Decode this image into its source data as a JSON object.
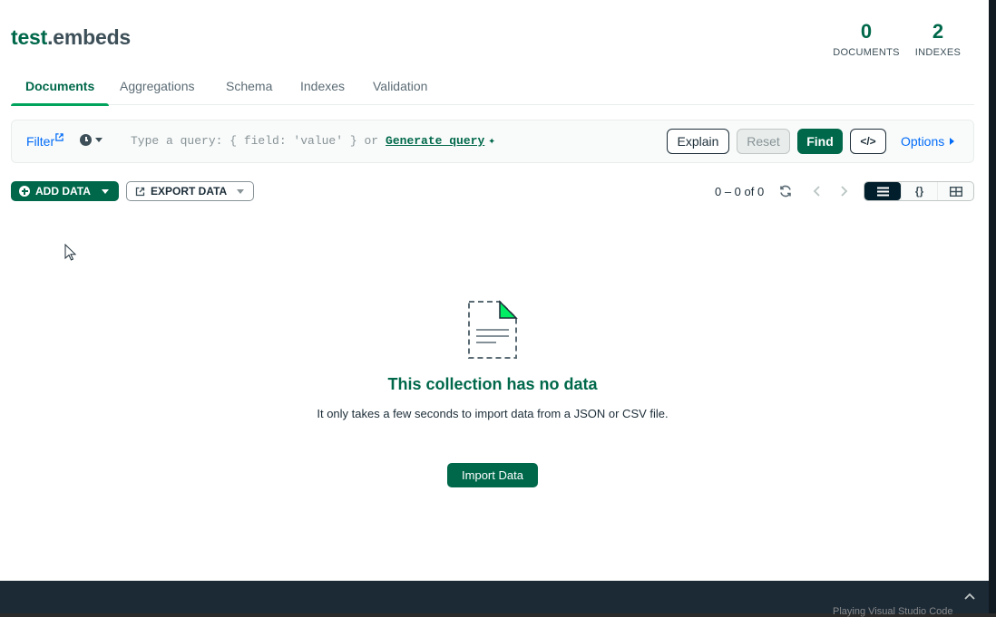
{
  "namespace": {
    "db": "test",
    "collection": ".embeds"
  },
  "stats": {
    "documents": {
      "value": "0",
      "label": "DOCUMENTS"
    },
    "indexes": {
      "value": "2",
      "label": "INDEXES"
    }
  },
  "tabs": [
    {
      "label": "Documents",
      "active": true
    },
    {
      "label": "Aggregations"
    },
    {
      "label": "Schema"
    },
    {
      "label": "Indexes"
    },
    {
      "label": "Validation"
    }
  ],
  "query_bar": {
    "filter_label": "Filter",
    "placeholder": "Type a query: { field: 'value' } or",
    "generate_label": "Generate query",
    "explain_label": "Explain",
    "reset_label": "Reset",
    "find_label": "Find",
    "code_label": "</>",
    "options_label": "Options"
  },
  "toolbar": {
    "add_data_label": "ADD DATA",
    "export_data_label": "EXPORT DATA",
    "pagination": "0 – 0 of 0",
    "view_modes": [
      "list",
      "json",
      "table"
    ]
  },
  "empty_state": {
    "title": "This collection has no data",
    "description": "It only takes a few seconds to import data from a JSON or CSV file.",
    "import_label": "Import Data"
  },
  "taskbar": {
    "text": "Playing Visual Studio Code"
  },
  "colors": {
    "brand_green": "#00684a",
    "accent_green": "#00a35c",
    "link_blue": "#016bf8",
    "dark": "#001e2b"
  }
}
